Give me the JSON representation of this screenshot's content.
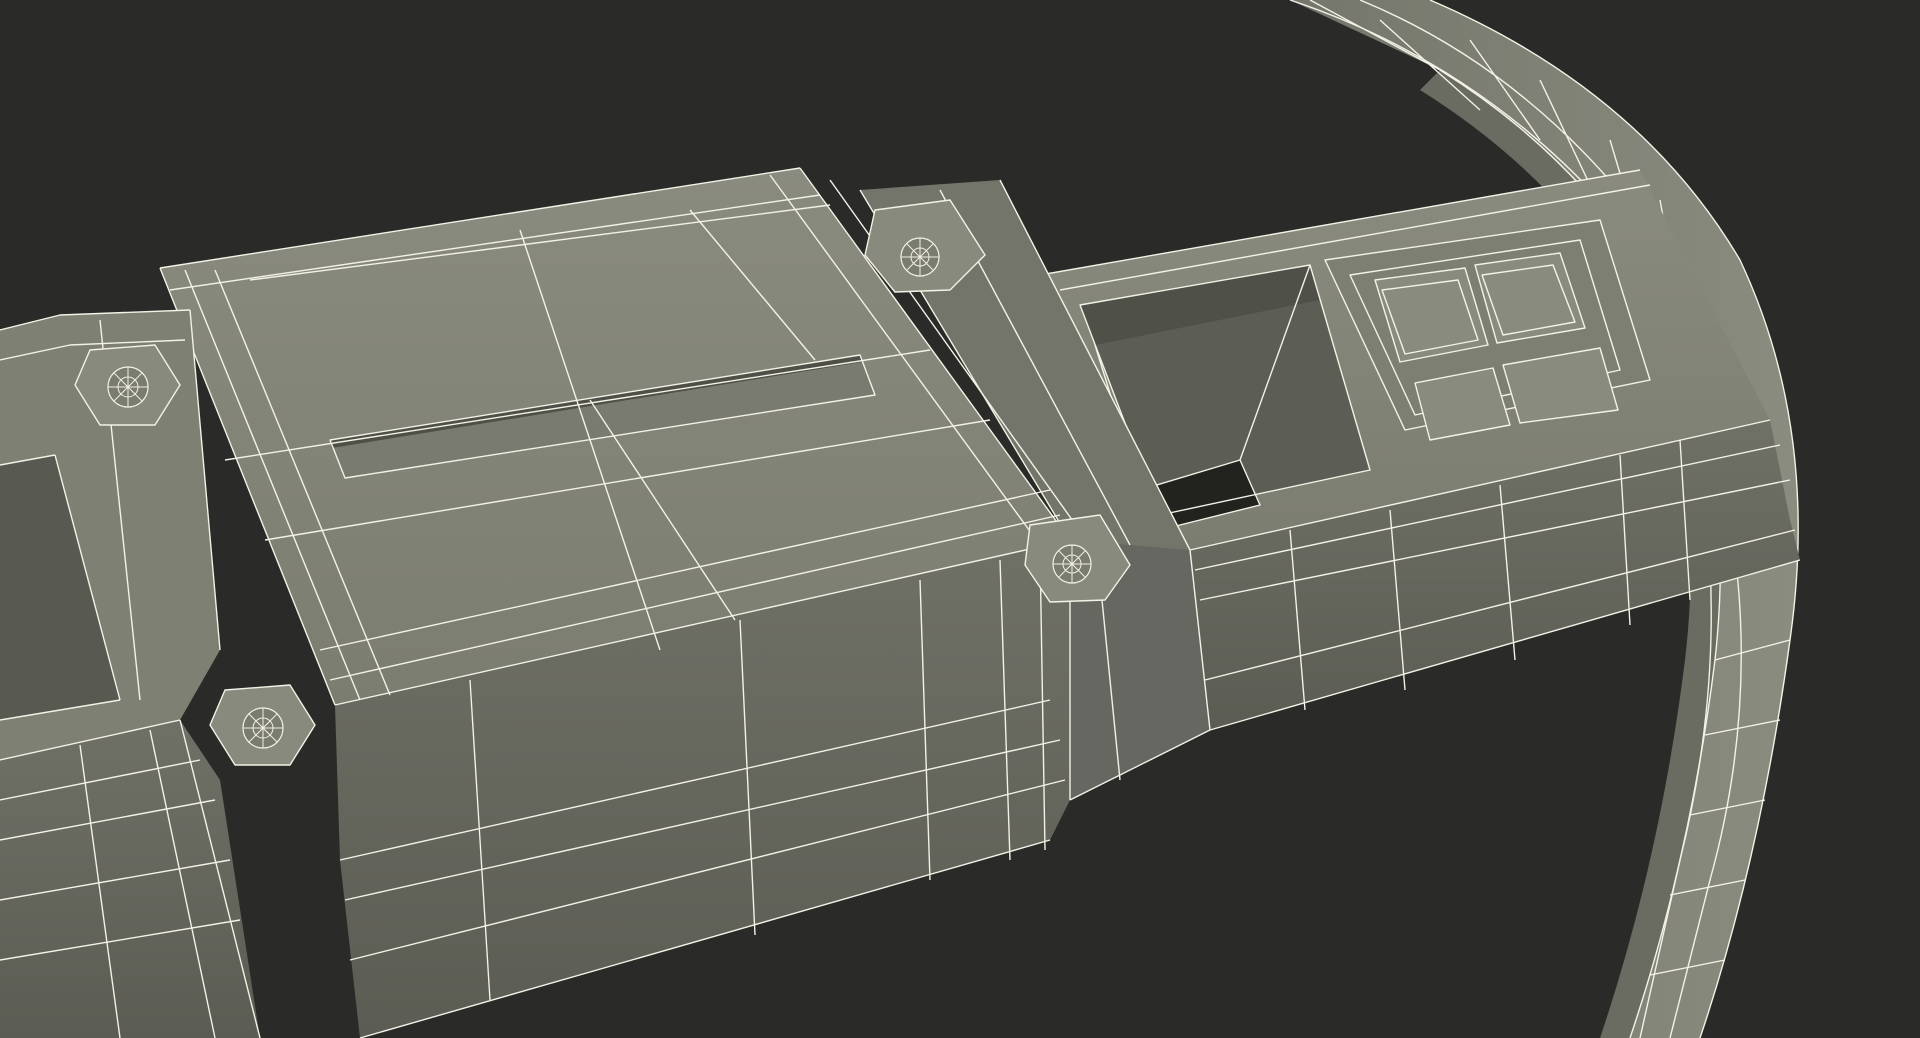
{
  "scene": {
    "subject": "steering-wheel-wireframe",
    "colors": {
      "background": "#2a2a28",
      "surface_light": "#85867a",
      "surface_mid": "#74756a",
      "surface_dark": "#5d5e55",
      "surface_shadow": "#4b4c44",
      "wire": "#f4f1e6"
    }
  }
}
